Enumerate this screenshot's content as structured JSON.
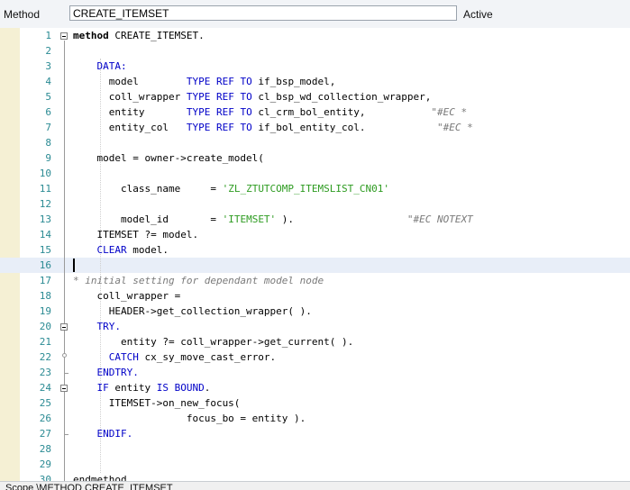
{
  "header": {
    "method_label": "Method",
    "method_value": "CREATE_ITEMSET",
    "status": "Active"
  },
  "editor": {
    "lines": [
      {
        "n": "1"
      },
      {
        "n": "2"
      },
      {
        "n": "3"
      },
      {
        "n": "4"
      },
      {
        "n": "5"
      },
      {
        "n": "6"
      },
      {
        "n": "7"
      },
      {
        "n": "8"
      },
      {
        "n": "9"
      },
      {
        "n": "10"
      },
      {
        "n": "11"
      },
      {
        "n": "12"
      },
      {
        "n": "13"
      },
      {
        "n": "14"
      },
      {
        "n": "15"
      },
      {
        "n": "16"
      },
      {
        "n": "17"
      },
      {
        "n": "18"
      },
      {
        "n": "19"
      },
      {
        "n": "20"
      },
      {
        "n": "21"
      },
      {
        "n": "22"
      },
      {
        "n": "23"
      },
      {
        "n": "24"
      },
      {
        "n": "25"
      },
      {
        "n": "26"
      },
      {
        "n": "27"
      },
      {
        "n": "28"
      },
      {
        "n": "29"
      },
      {
        "n": "30"
      }
    ],
    "tokens": {
      "l1a": "method",
      "l1b": " CREATE_ITEMSET.",
      "l3a": "    DATA:",
      "l4a": "      model        ",
      "l4b": "TYPE REF TO",
      "l4c": " if_bsp_model,",
      "l5a": "      coll_wrapper ",
      "l5b": "TYPE REF TO",
      "l5c": " cl_bsp_wd_collection_wrapper,",
      "l6a": "      entity       ",
      "l6b": "TYPE REF TO",
      "l6c": " cl_crm_bol_entity,",
      "l6d": "           \"#EC *",
      "l7a": "      entity_col   ",
      "l7b": "TYPE REF TO",
      "l7c": " if_bol_entity_col.",
      "l7d": "            \"#EC *",
      "l9a": "    model = owner->create_model(",
      "l11a": "        class_name     = ",
      "l11b": "'ZL_ZTUTCOMP_ITEMSLIST_CN01'",
      "l13a": "        model_id       = ",
      "l13b": "'ITEMSET'",
      "l13c": " ).",
      "l13d": "                   \"#EC NOTEXT",
      "l14a": "    ITEMSET ?= model.",
      "l15a": "    CLEAR",
      "l15b": " model.",
      "l17a": "* initial setting for dependant model node",
      "l18a": "    coll_wrapper =",
      "l19a": "      HEADER->get_collection_wrapper( ).",
      "l20a": "    TRY.",
      "l21a": "        entity ?= coll_wrapper->get_current( ).",
      "l22a": "      CATCH",
      "l22b": " cx_sy_move_cast_error.",
      "l23a": "    ENDTRY.",
      "l24a": "    IF",
      "l24b": " entity ",
      "l24c": "IS BOUND",
      "l24d": ".",
      "l25a": "      ITEMSET->on_new_focus(",
      "l26a": "                   focus_bo = entity ).",
      "l27a": "    ENDIF.",
      "l30a": "endmethod."
    }
  },
  "statusbar": {
    "scope": "Scope \\METHOD CREATE_ITEMSET"
  },
  "colors": {
    "keyword": "#0000c8",
    "string": "#2d9b20",
    "comment": "#7a7a7a",
    "line_number": "#2a8a93",
    "marker": "#f5f0d4"
  }
}
